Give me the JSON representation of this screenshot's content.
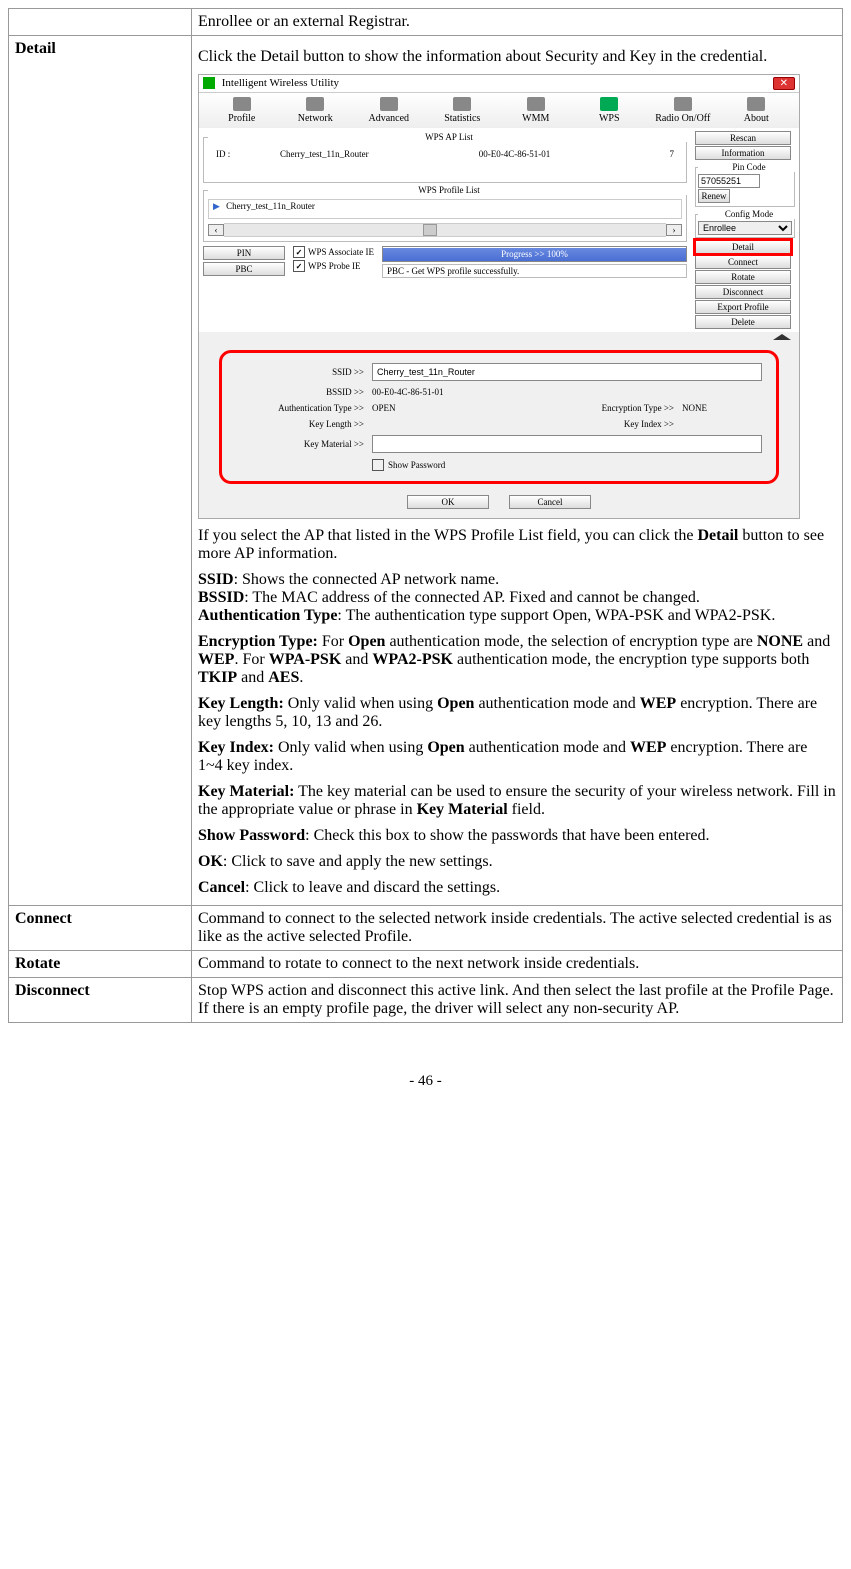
{
  "rows": {
    "prev_desc": "Enrollee or an external Registrar.",
    "detail_label": "Detail",
    "connect_label": "Connect",
    "connect_desc": "Command to connect to the selected network inside credentials. The active selected credential is as like as the active selected Profile.",
    "rotate_label": "Rotate",
    "rotate_desc": "Command to rotate to connect to the next network inside credentials.",
    "disconnect_label": "Disconnect",
    "disconnect_desc": "Stop WPS action and disconnect this active link. And then select the last profile at the Profile Page. If there is an empty profile page, the driver will select any non-security AP."
  },
  "detail_desc": {
    "intro": "Click the Detail button to show the information about Security and Key in the credential.",
    "after1_a": "If you select the AP that listed in the WPS Profile List field, you can click the ",
    "after1_b": "Detail",
    "after1_c": " button to see more AP information.",
    "ssid_b": "SSID",
    "ssid_t": ": Shows the connected AP network name.",
    "bssid_b": "BSSID",
    "bssid_t": ": The MAC address of the connected AP. Fixed and cannot be changed.",
    "auth_b": "Authentication Type",
    "auth_t": ": The authentication type support Open, WPA-PSK and WPA2-PSK.",
    "enc_b": "Encryption Type:",
    "enc_t1": " For ",
    "enc_b2": "Open",
    "enc_t2": " authentication mode, the selection of encryption type are ",
    "enc_b3": "NONE",
    "enc_t3": " and ",
    "enc_b4": "WEP",
    "enc_t4": ". For ",
    "enc_b5": "WPA-PSK",
    "enc_t5": " and ",
    "enc_b6": "WPA2-PSK",
    "enc_t6": " authentication mode, the encryption type supports both ",
    "enc_b7": "TKIP",
    "enc_t7": " and ",
    "enc_b8": "AES",
    "enc_t8": ".",
    "kl_b": "Key Length:",
    "kl_t1": " Only valid when using ",
    "kl_b2": "Open",
    "kl_t2": " authentication mode and ",
    "kl_b3": "WEP",
    "kl_t3": " encryption. There are key lengths 5, 10, 13 and 26.",
    "ki_b": "Key Index:",
    "ki_t1": " Only valid when using ",
    "ki_b2": "Open",
    "ki_t2": " authentication mode and ",
    "ki_b3": "WEP",
    "ki_t3": " encryption. There are 1~4 key index.",
    "km_b": "Key Material:",
    "km_t1": " The key material can be used to ensure the security of your wireless network. Fill in the appropriate value or phrase in ",
    "km_b2": "Key Material",
    "km_t2": " field.",
    "sp_b": "Show Password",
    "sp_t": ": Check this box to show the passwords that have been entered.",
    "ok_b": "OK",
    "ok_t": ": Click to save and apply the new settings.",
    "cancel_b": "Cancel",
    "cancel_t": ": Click to leave and discard the settings."
  },
  "app": {
    "title": "Intelligent Wireless Utility",
    "toolbar": [
      "Profile",
      "Network",
      "Advanced",
      "Statistics",
      "WMM",
      "WPS",
      "Radio On/Off",
      "About"
    ],
    "aplist_legend": "WPS AP List",
    "aplist_id_label": "ID :",
    "ap": {
      "ssid": "Cherry_test_11n_Router",
      "bssid": "00-E0-4C-86-51-01",
      "channel": "7"
    },
    "profile_legend": "WPS Profile List",
    "profile_item": "Cherry_test_11n_Router",
    "side": {
      "rescan": "Rescan",
      "information": "Information",
      "pincode": "Pin Code",
      "pin_val": "57055251",
      "renew": "Renew",
      "config_mode": "Config Mode",
      "config_sel": "Enrollee",
      "detail": "Detail",
      "connect": "Connect",
      "rotate": "Rotate",
      "disconnect": "Disconnect",
      "export": "Export Profile",
      "delete": "Delete"
    },
    "ctrl": {
      "pin": "PIN",
      "pbc": "PBC",
      "assoc": "WPS Associate IE",
      "probe": "WPS Probe IE",
      "progress": "Progress >> 100%",
      "status": "PBC - Get WPS profile successfully."
    },
    "detail": {
      "ssid_l": "SSID >>",
      "ssid_v": "Cherry_test_11n_Router",
      "bssid_l": "BSSID >>",
      "bssid_v": "00-E0-4C-86-51-01",
      "auth_l": "Authentication Type >>",
      "auth_v": "OPEN",
      "enc_l": "Encryption Type >>",
      "enc_v": "NONE",
      "kl_l": "Key Length >>",
      "ki_l": "Key Index >>",
      "km_l": "Key Material >>",
      "show_pw": "Show Password",
      "ok": "OK",
      "cancel": "Cancel"
    }
  },
  "page_num": "- 46 -"
}
